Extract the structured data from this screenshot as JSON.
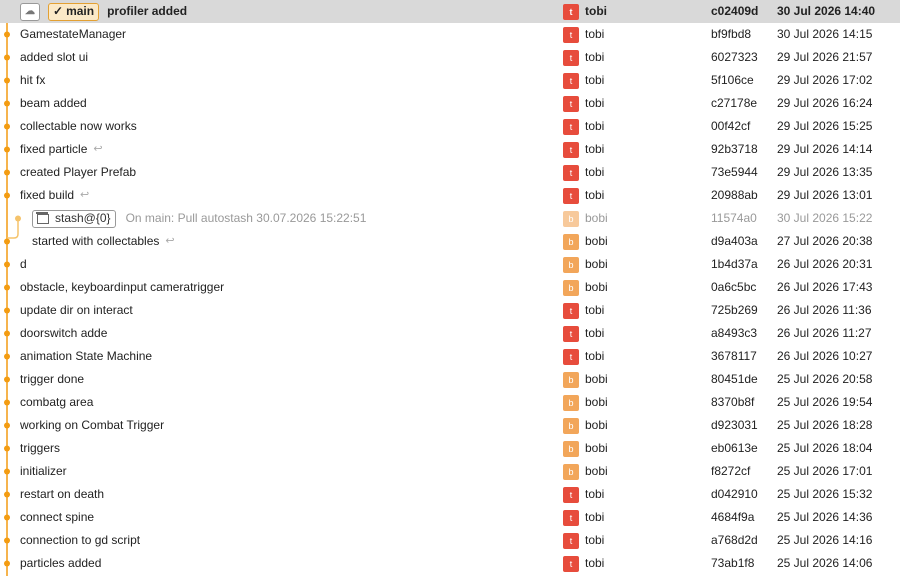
{
  "colors": {
    "graph": "#f39c12",
    "head_bg": "#d9d9d9",
    "avatar_t": "#e74c3c",
    "avatar_b": "#f2a65a"
  },
  "branch": {
    "name": "main"
  },
  "stash": {
    "tag": "stash@{0}"
  },
  "commits": [
    {
      "message": "profiler added",
      "author": "tobi",
      "initial": "t",
      "hash": "c02409d",
      "date": "30 Jul 2026 14:40",
      "head": true
    },
    {
      "message": "GamestateManager",
      "author": "tobi",
      "initial": "t",
      "hash": "bf9fbd8",
      "date": "30 Jul 2026 14:15"
    },
    {
      "message": "added slot ui",
      "author": "tobi",
      "initial": "t",
      "hash": "6027323",
      "date": "29 Jul 2026 21:57"
    },
    {
      "message": "hit fx",
      "author": "tobi",
      "initial": "t",
      "hash": "5f106ce",
      "date": "29 Jul 2026 17:02"
    },
    {
      "message": "beam added",
      "author": "tobi",
      "initial": "t",
      "hash": "c27178e",
      "date": "29 Jul 2026 16:24"
    },
    {
      "message": "collectable now works",
      "author": "tobi",
      "initial": "t",
      "hash": "00f42cf",
      "date": "29 Jul 2026 15:25"
    },
    {
      "message": "fixed particle",
      "author": "tobi",
      "initial": "t",
      "hash": "92b3718",
      "date": "29 Jul 2026 14:14",
      "wrap": true
    },
    {
      "message": "created Player Prefab",
      "author": "tobi",
      "initial": "t",
      "hash": "73e5944",
      "date": "29 Jul 2026 13:35"
    },
    {
      "message": "fixed build",
      "author": "tobi",
      "initial": "t",
      "hash": "20988ab",
      "date": "29 Jul 2026 13:01",
      "wrap": true
    },
    {
      "message": "On main: Pull autostash 30.07.2026 15:22:51",
      "author": "bobi",
      "initial": "b",
      "hash": "11574a0",
      "date": "30 Jul 2026 15:22",
      "stash": true
    },
    {
      "message": "started with collectables",
      "author": "bobi",
      "initial": "b",
      "hash": "d9a403a",
      "date": "27 Jul 2026 20:38",
      "wrap": true,
      "sub": true
    },
    {
      "message": "d",
      "author": "bobi",
      "initial": "b",
      "hash": "1b4d37a",
      "date": "26 Jul 2026 20:31"
    },
    {
      "message": "obstacle, keyboardinput cameratrigger",
      "author": "bobi",
      "initial": "b",
      "hash": "0a6c5bc",
      "date": "26 Jul 2026 17:43"
    },
    {
      "message": "update dir on interact",
      "author": "tobi",
      "initial": "t",
      "hash": "725b269",
      "date": "26 Jul 2026 11:36"
    },
    {
      "message": "doorswitch adde",
      "author": "tobi",
      "initial": "t",
      "hash": "a8493c3",
      "date": "26 Jul 2026 11:27"
    },
    {
      "message": "animation State Machine",
      "author": "tobi",
      "initial": "t",
      "hash": "3678117",
      "date": "26 Jul 2026 10:27"
    },
    {
      "message": "trigger done",
      "author": "bobi",
      "initial": "b",
      "hash": "80451de",
      "date": "25 Jul 2026 20:58"
    },
    {
      "message": "combatg area",
      "author": "bobi",
      "initial": "b",
      "hash": "8370b8f",
      "date": "25 Jul 2026 19:54"
    },
    {
      "message": "working on Combat Trigger",
      "author": "bobi",
      "initial": "b",
      "hash": "d923031",
      "date": "25 Jul 2026 18:28"
    },
    {
      "message": "triggers",
      "author": "bobi",
      "initial": "b",
      "hash": "eb0613e",
      "date": "25 Jul 2026 18:04"
    },
    {
      "message": "initializer",
      "author": "bobi",
      "initial": "b",
      "hash": "f8272cf",
      "date": "25 Jul 2026 17:01"
    },
    {
      "message": "restart on death",
      "author": "tobi",
      "initial": "t",
      "hash": "d042910",
      "date": "25 Jul 2026 15:32"
    },
    {
      "message": "connect spine",
      "author": "tobi",
      "initial": "t",
      "hash": "4684f9a",
      "date": "25 Jul 2026 14:36"
    },
    {
      "message": "connection to gd script",
      "author": "tobi",
      "initial": "t",
      "hash": "a768d2d",
      "date": "25 Jul 2026 14:16"
    },
    {
      "message": "particles added",
      "author": "tobi",
      "initial": "t",
      "hash": "73ab1f8",
      "date": "25 Jul 2026 14:06"
    }
  ]
}
